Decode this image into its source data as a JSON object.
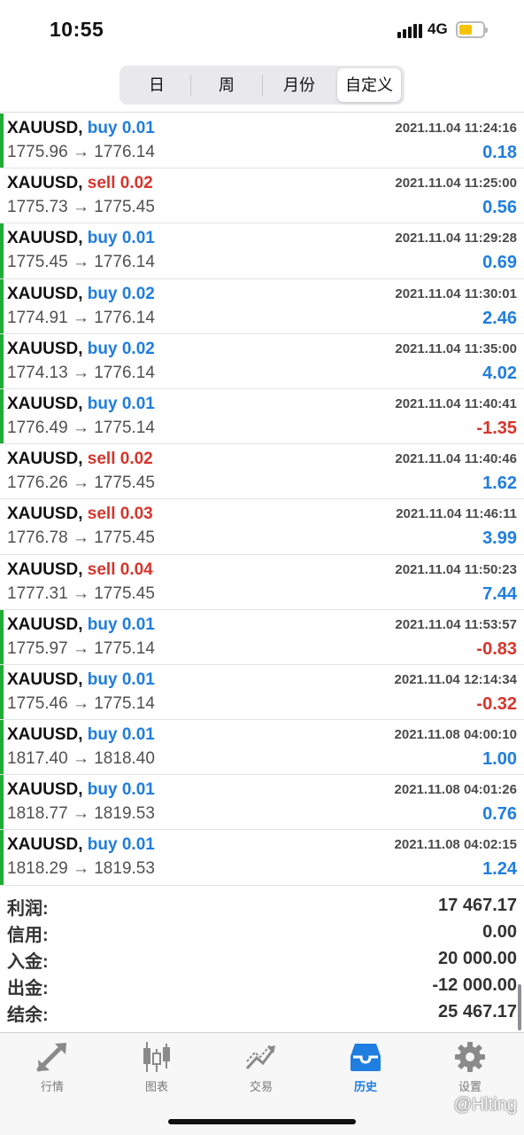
{
  "status_bar": {
    "time": "10:55",
    "network": "4G",
    "battery_level": 0.55
  },
  "period_tabs": [
    {
      "label": "日",
      "active": false
    },
    {
      "label": "周",
      "active": false
    },
    {
      "label": "月份",
      "active": false
    },
    {
      "label": "自定义",
      "active": true
    }
  ],
  "trades": [
    {
      "symbol": "XAUUSD,",
      "side": "buy 0.01",
      "time": "2021.11.04 11:24:16",
      "prices": "1775.96 → 1776.14",
      "profit": "0.18"
    },
    {
      "symbol": "XAUUSD,",
      "side": "sell 0.02",
      "time": "2021.11.04 11:25:00",
      "prices": "1775.73 → 1775.45",
      "profit": "0.56"
    },
    {
      "symbol": "XAUUSD,",
      "side": "buy 0.01",
      "time": "2021.11.04 11:29:28",
      "prices": "1775.45 → 1776.14",
      "profit": "0.69"
    },
    {
      "symbol": "XAUUSD,",
      "side": "buy 0.02",
      "time": "2021.11.04 11:30:01",
      "prices": "1774.91 → 1776.14",
      "profit": "2.46"
    },
    {
      "symbol": "XAUUSD,",
      "side": "buy 0.02",
      "time": "2021.11.04 11:35:00",
      "prices": "1774.13 → 1776.14",
      "profit": "4.02"
    },
    {
      "symbol": "XAUUSD,",
      "side": "buy 0.01",
      "time": "2021.11.04 11:40:41",
      "prices": "1776.49 → 1775.14",
      "profit": "-1.35"
    },
    {
      "symbol": "XAUUSD,",
      "side": "sell 0.02",
      "time": "2021.11.04 11:40:46",
      "prices": "1776.26 → 1775.45",
      "profit": "1.62"
    },
    {
      "symbol": "XAUUSD,",
      "side": "sell 0.03",
      "time": "2021.11.04 11:46:11",
      "prices": "1776.78 → 1775.45",
      "profit": "3.99"
    },
    {
      "symbol": "XAUUSD,",
      "side": "sell 0.04",
      "time": "2021.11.04 11:50:23",
      "prices": "1777.31 → 1775.45",
      "profit": "7.44"
    },
    {
      "symbol": "XAUUSD,",
      "side": "buy 0.01",
      "time": "2021.11.04 11:53:57",
      "prices": "1775.97 → 1775.14",
      "profit": "-0.83"
    },
    {
      "symbol": "XAUUSD,",
      "side": "buy 0.01",
      "time": "2021.11.04 12:14:34",
      "prices": "1775.46 → 1775.14",
      "profit": "-0.32"
    },
    {
      "symbol": "XAUUSD,",
      "side": "buy 0.01",
      "time": "2021.11.08 04:00:10",
      "prices": "1817.40 → 1818.40",
      "profit": "1.00"
    },
    {
      "symbol": "XAUUSD,",
      "side": "buy 0.01",
      "time": "2021.11.08 04:01:26",
      "prices": "1818.77 → 1819.53",
      "profit": "0.76"
    },
    {
      "symbol": "XAUUSD,",
      "side": "buy 0.01",
      "time": "2021.11.08 04:02:15",
      "prices": "1818.29 → 1819.53",
      "profit": "1.24"
    }
  ],
  "summary": [
    {
      "label": "利润:",
      "value": "17 467.17"
    },
    {
      "label": "信用:",
      "value": "0.00"
    },
    {
      "label": "入金:",
      "value": "20 000.00"
    },
    {
      "label": "出金:",
      "value": "-12 000.00"
    },
    {
      "label": "结余:",
      "value": "25 467.17"
    }
  ],
  "tab_bar": [
    {
      "label": "行情",
      "icon": "arrows-icon",
      "active": false
    },
    {
      "label": "图表",
      "icon": "candlestick-icon",
      "active": false
    },
    {
      "label": "交易",
      "icon": "trade-chart-icon",
      "active": false
    },
    {
      "label": "历史",
      "icon": "inbox-icon",
      "active": true
    },
    {
      "label": "设置",
      "icon": "gear-icon",
      "active": false
    }
  ],
  "watermark": "@Hlting",
  "colors": {
    "buy": "#1f7ee0",
    "sell": "#d8342b",
    "profit_positive": "#1f7ee0",
    "profit_negative": "#d8342b",
    "row_marker": "#21ad35",
    "active_tab": "#1f7ee0"
  }
}
